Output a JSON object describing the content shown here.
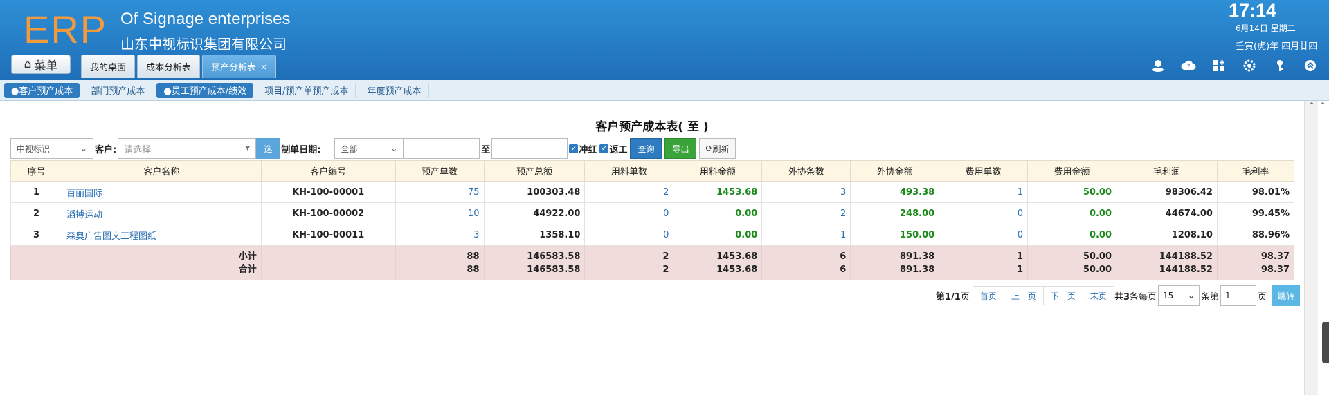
{
  "header": {
    "logo": "ERP",
    "company_en": "Of Signage enterprises",
    "company_cn": "山东中视标识集团有限公司",
    "time": "17:14",
    "date": "6月14日 星期二",
    "lunar": "壬寅(虎)年 四月廿四",
    "menu_label": "菜单",
    "tabs": [
      {
        "label": "我的桌面"
      },
      {
        "label": "成本分析表"
      },
      {
        "label": "预产分析表",
        "close": "×"
      }
    ]
  },
  "subnav": [
    {
      "label": "●客户预产成本"
    },
    {
      "label": "部门预产成本"
    },
    {
      "label": "●员工预产成本/绩效"
    },
    {
      "label": "项目/预产单预产成本"
    },
    {
      "label": "年度预产成本"
    }
  ],
  "report": {
    "title": "客户预产成本表( 至 )"
  },
  "filter": {
    "company": "中视标识",
    "customer_label": "客户:",
    "customer_placeholder": "请选择",
    "select_btn": "选",
    "date_label": "制单日期:",
    "date_mode": "全部",
    "to_label": "至",
    "chk_red": "冲红",
    "chk_rework": "返工",
    "query": "查询",
    "export": "导出",
    "refresh": "刷新"
  },
  "table": {
    "headers": [
      "序号",
      "客户名称",
      "客户编号",
      "预产单数",
      "预产总额",
      "用料单数",
      "用料金额",
      "外协条数",
      "外协金额",
      "费用单数",
      "费用金额",
      "毛利润",
      "毛利率"
    ],
    "rows": [
      {
        "no": "1",
        "name": "百丽国际",
        "code": "KH-100-00001",
        "orders": "75",
        "total": "100303.48",
        "mat_cnt": "2",
        "mat_amt": "1453.68",
        "out_cnt": "3",
        "out_amt": "493.38",
        "fee_cnt": "1",
        "fee_amt": "50.00",
        "profit": "98306.42",
        "rate": "98.01%"
      },
      {
        "no": "2",
        "name": "滔搏运动",
        "code": "KH-100-00002",
        "orders": "10",
        "total": "44922.00",
        "mat_cnt": "0",
        "mat_amt": "0.00",
        "out_cnt": "2",
        "out_amt": "248.00",
        "fee_cnt": "0",
        "fee_amt": "0.00",
        "profit": "44674.00",
        "rate": "99.45%"
      },
      {
        "no": "3",
        "name": "森奥广告图文工程图纸",
        "code": "KH-100-00011",
        "orders": "3",
        "total": "1358.10",
        "mat_cnt": "0",
        "mat_amt": "0.00",
        "out_cnt": "1",
        "out_amt": "150.00",
        "fee_cnt": "0",
        "fee_amt": "0.00",
        "profit": "1208.10",
        "rate": "88.96%"
      }
    ],
    "subtotal": {
      "label": "小计",
      "orders": "88",
      "total": "146583.58",
      "mat_cnt": "2",
      "mat_amt": "1453.68",
      "out_cnt": "6",
      "out_amt": "891.38",
      "fee_cnt": "1",
      "fee_amt": "50.00",
      "profit": "144188.52",
      "rate": "98.37"
    },
    "grandtotal": {
      "label": "合计",
      "orders": "88",
      "total": "146583.58",
      "mat_cnt": "2",
      "mat_amt": "1453.68",
      "out_cnt": "6",
      "out_amt": "891.38",
      "fee_cnt": "1",
      "fee_amt": "50.00",
      "profit": "144188.52",
      "rate": "98.37"
    }
  },
  "pager": {
    "page_info_pre": "第",
    "page_info_val": "1/1",
    "page_info_post": "页",
    "first": "首页",
    "prev": "上一页",
    "next": "下一页",
    "last": "末页",
    "total_pre": "共",
    "total_val": "3",
    "total_post": "条每页",
    "per_page": "15",
    "goto_pre": "条第",
    "goto_val": "1",
    "goto_post": "页",
    "go": "跳转"
  }
}
